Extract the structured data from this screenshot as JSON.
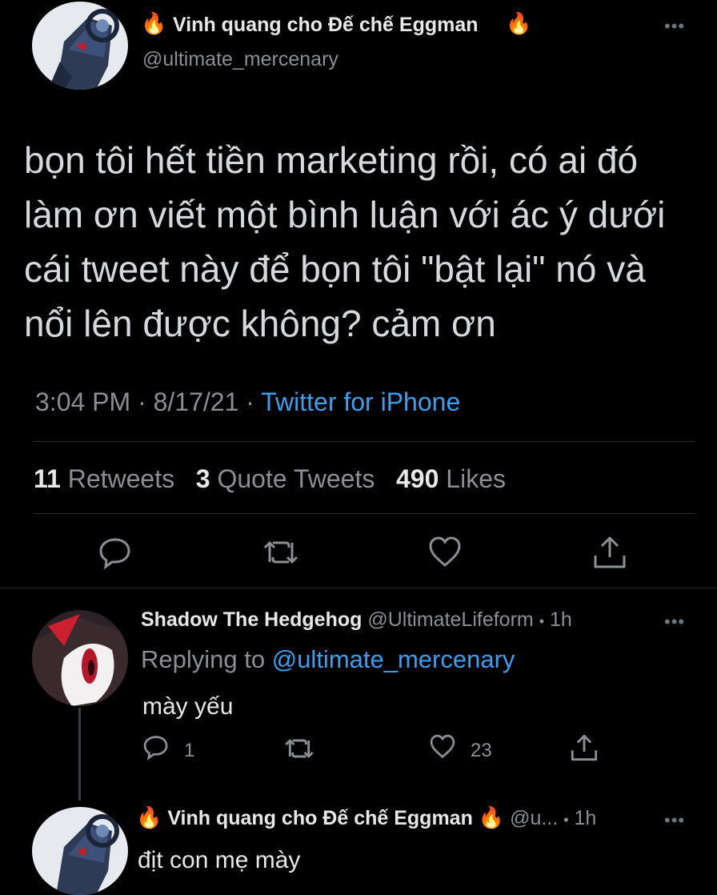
{
  "main_tweet": {
    "fire_left": "🔥",
    "display_name": "Vinh quang cho Đế chế Eggman",
    "fire_right": "🔥",
    "handle": "@ultimate_mercenary",
    "text_lines": [
      "bọn tôi hết tiền marketing rồi, có ai đó",
      "làm ơn viết một bình luận với ác ý dưới",
      "cái tweet này để bọn tôi \"bật lại\" nó và",
      "nổi lên được không? cảm ơn"
    ],
    "time": "3:04 PM",
    "sep1": "·",
    "date": "8/17/21",
    "sep2": "·",
    "source": "Twitter for iPhone",
    "stats": {
      "retweets_count": "11",
      "retweets_label": "Retweets",
      "quotes_count": "3",
      "quotes_label": "Quote Tweets",
      "likes_count": "490",
      "likes_label": "Likes"
    },
    "more": "•••",
    "icons": [
      "avatar-icon",
      "reply-icon",
      "retweet-icon",
      "like-icon",
      "share-icon",
      "more-icon"
    ]
  },
  "reply": {
    "display_name": "Shadow The Hedgehog",
    "handle": "@UltimateLifeform",
    "sep": "•",
    "time": "1h",
    "replying_prefix": "Replying to",
    "replying_handle": "@ultimate_mercenary",
    "text": "mày yếu",
    "reply_count": "1",
    "like_count": "23",
    "more": "•••"
  },
  "reply2": {
    "fire_left": "🔥",
    "display_name": "Vinh quang cho Đế chế Eggman",
    "fire_right": "🔥",
    "handle": "@u...",
    "sep": "•",
    "time": "1h",
    "text": "địt con mẹ mày",
    "more": "•••"
  },
  "colors": {
    "background": "#000000",
    "link": "#3a9ff0",
    "muted": "#8b8f94",
    "divider": "#2b2f33"
  }
}
